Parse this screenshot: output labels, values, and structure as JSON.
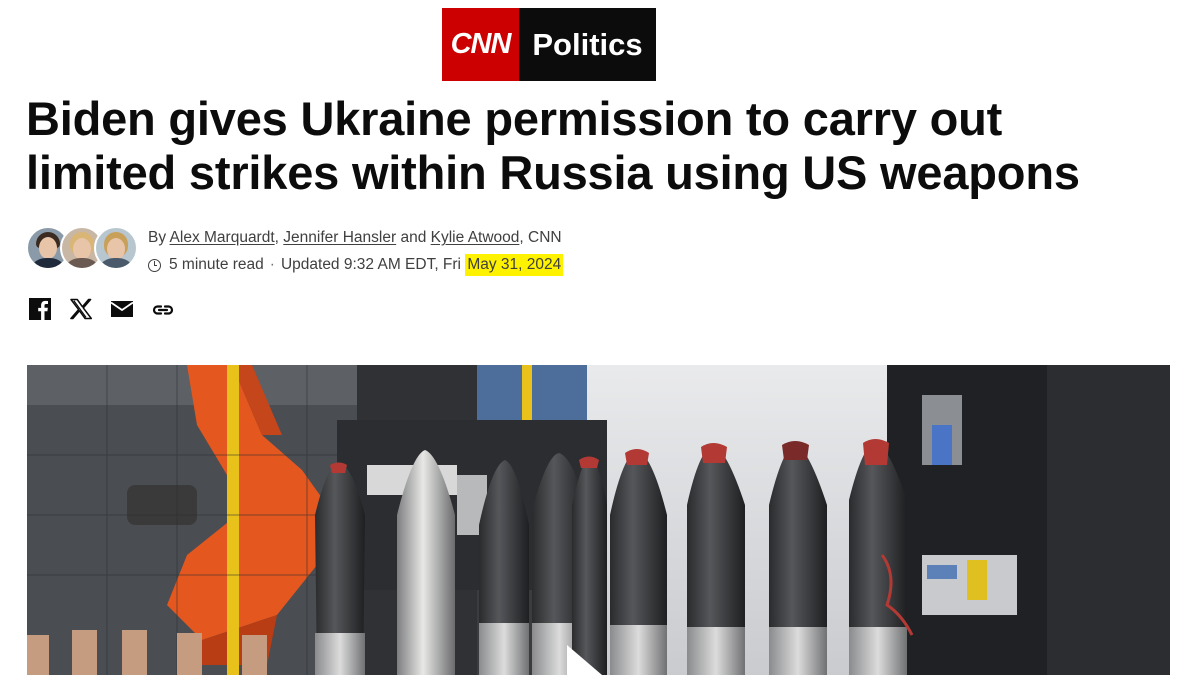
{
  "logo": {
    "brand": "CNN",
    "section": "Politics",
    "brand_color": "#cc0000",
    "section_bg": "#0c0c0c"
  },
  "article": {
    "headline_line1": "Biden gives Ukraine permission to carry out",
    "headline_line2": "limited strikes within Russia using US weapons",
    "byline_prefix": "By",
    "authors": [
      "Alex Marquardt",
      "Jennifer Hansler",
      "Kylie Atwood"
    ],
    "author_sep1": ",",
    "author_sep2": "and",
    "source": ", CNN",
    "read_time": "5 minute read",
    "updated_prefix": "Updated 9:32 AM EDT, Fri",
    "date": "May 31, 2024",
    "highlight_color": "#fff200"
  },
  "social": {
    "icons": [
      "facebook-icon",
      "x-icon",
      "email-icon",
      "link-icon"
    ]
  },
  "hero": {
    "icons": [
      "play-icon"
    ]
  }
}
